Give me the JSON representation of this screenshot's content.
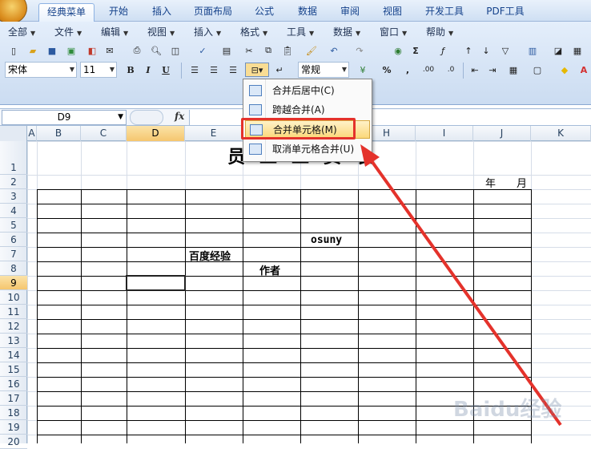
{
  "ribbon_tabs": [
    "经典菜单",
    "开始",
    "插入",
    "页面布局",
    "公式",
    "数据",
    "审阅",
    "视图",
    "开发工具",
    "PDF工具"
  ],
  "menu_bar": [
    "全部",
    "文件",
    "编辑",
    "视图",
    "插入",
    "格式",
    "工具",
    "数据",
    "窗口",
    "帮助"
  ],
  "font": {
    "name": "宋体",
    "size": "11"
  },
  "format_style": "常规",
  "format_buttons": {
    "bold": "B",
    "italic": "I",
    "underline": "U",
    "percent": "%",
    "comma": ","
  },
  "name_box": "D9",
  "fx_label": "fx",
  "columns": [
    "A",
    "B",
    "C",
    "D",
    "E",
    "F",
    "G",
    "H",
    "I",
    "J",
    "K"
  ],
  "selected_column": "D",
  "rows": [
    "1",
    "2",
    "3",
    "4",
    "5",
    "6",
    "7",
    "8",
    "9",
    "10",
    "11",
    "12",
    "13",
    "14",
    "15",
    "16",
    "17",
    "18",
    "19",
    "20"
  ],
  "selected_row": "9",
  "sheet": {
    "title": "员工工资表",
    "year_month": "年　　月",
    "cells": {
      "g6": "osuny",
      "e7": "百度经验",
      "f8": "作者"
    }
  },
  "merge_menu": {
    "items": [
      {
        "label": "合并后居中(C)"
      },
      {
        "label": "跨越合并(A)"
      },
      {
        "label": "合并单元格(M)"
      },
      {
        "label": "取消单元格合并(U)"
      }
    ],
    "highlighted_index": 2
  },
  "watermark": "Baidu经验",
  "colors": {
    "accent_red": "#e4322b",
    "selection": "#f5c66e",
    "ribbon": "#cbdcf1"
  }
}
